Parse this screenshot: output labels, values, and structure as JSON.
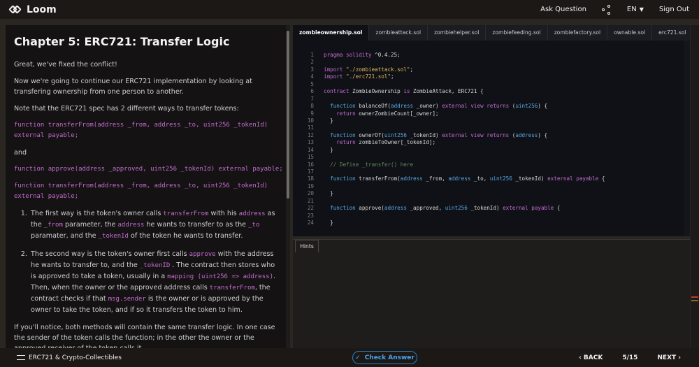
{
  "header": {
    "logo_text": "Loom",
    "ask_question": "Ask Question",
    "language": "EN",
    "sign_out": "Sign Out"
  },
  "lesson": {
    "title": "Chapter 5: ERC721: Transfer Logic",
    "p1": "Great, we've fixed the conflict!",
    "p2": "Now we're going to continue our ERC721 implementation by looking at transfering ownership from one person to another.",
    "p3": "Note that the ERC721 spec has 2 different ways to transfer tokens:",
    "code1a": "function transferFrom(address _from, address _to, uint256 _tokenId)",
    "code1b": "external payable;",
    "and": "and",
    "code2": "function approve(address _approved, uint256 _tokenId) external payable;",
    "code3a": "function transferFrom(address _from, address _to, uint256 _tokenId)",
    "code3b": "external payable;",
    "li1": {
      "t1": "The first way is the token's owner calls ",
      "c1": "transferFrom",
      "t2": " with his ",
      "c2": "address",
      "t3": " as the ",
      "c3": "_from",
      "t4": " parameter, the ",
      "c4": "address",
      "t5": " he wants to transfer to as the ",
      "c5": "_to",
      "t6": " paramater, and the ",
      "c6": "_tokenId",
      "t7": " of the token he wants to transfer."
    },
    "li2": {
      "t1": "The second way is the token's owner first calls ",
      "c1": "approve",
      "t2": " with the address he wants to transfer to, and the ",
      "c2": "_tokenID",
      "t3": " . The contract then stores who is approved to take a token, usually in a ",
      "c3": "mapping (uint256 => address)",
      "t4": ". Then, when the owner or the approved address calls ",
      "c4": "transferFrom",
      "t5": ", the contract checks if that ",
      "c5": "msg.sender",
      "t6": " is the owner or is approved by the owner to take the token, and if so it transfers the token to him."
    },
    "p4": "If you'll notice, both methods will contain the same transfer logic. In one case the sender of the token calls the function; in the other the owner or the approved receiver of the token calls it."
  },
  "editor": {
    "tabs": [
      "zombieownership.sol",
      "zombieattack.sol",
      "zombiehelper.sol",
      "zombiefeeding.sol",
      "zombiefactory.sol",
      "ownable.sol",
      "erc721.sol"
    ],
    "lines": [
      "1",
      "2",
      "3",
      "4",
      "5",
      "6",
      "7",
      "8",
      "9",
      "10",
      "11",
      "12",
      "13",
      "14",
      "15",
      "16",
      "17",
      "18",
      "19",
      "20",
      "21",
      "22",
      "23",
      "24"
    ]
  },
  "hints": {
    "tab_label": "Hints"
  },
  "footer": {
    "course": "ERC721 & Crypto-Collectibles",
    "check_answer": "Check Answer",
    "back": "BACK",
    "progress": "5/15",
    "next": "NEXT"
  },
  "colors": {
    "accent": "#4aa2ea",
    "code_purple": "#c46cd1",
    "string": "#e3b65b",
    "type": "#5aa7e0"
  }
}
